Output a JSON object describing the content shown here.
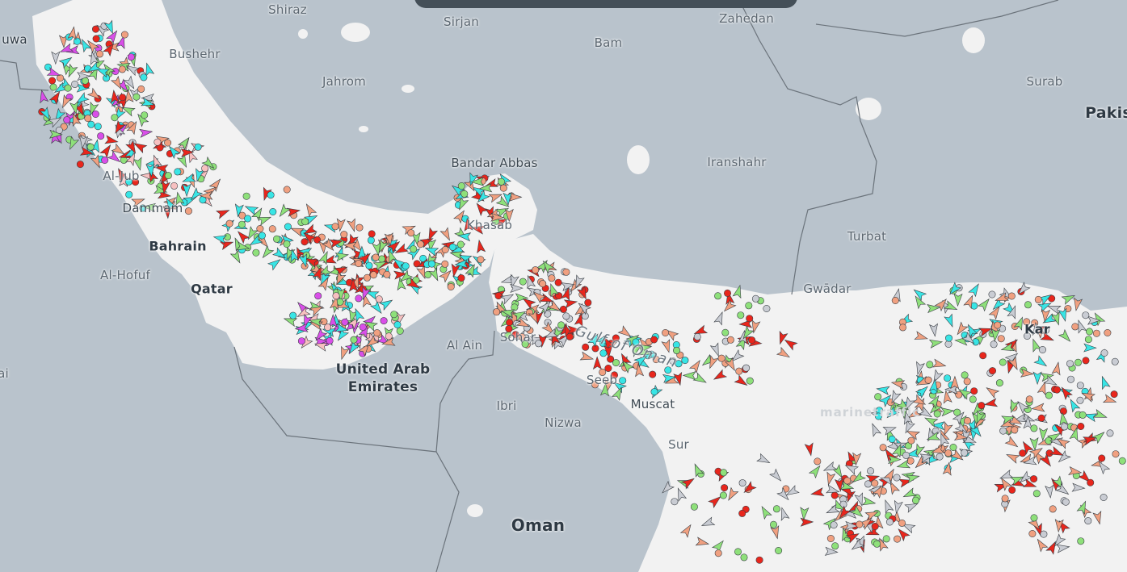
{
  "map": {
    "labels": {
      "shiraz": "Shiraz",
      "sirjan": "Sirjan",
      "zahedan": "Zahedan",
      "kuwait": "uwa",
      "bushehr": "Bushehr",
      "bam": "Bam",
      "jahrom": "Jahrom",
      "surab": "Surab",
      "pakistan": "Pakis",
      "bandar_abbas": "Bandar Abbas",
      "iranshahr": "Iranshahr",
      "al_jubail": "Al-Jub",
      "dammam": "Dammam",
      "bahrain": "Bahrain",
      "turbat": "Turbat",
      "khasab": "Khasab",
      "al_hofuf": "Al-Hofuf",
      "qatar": "Qatar",
      "gwadar": "Gwādar",
      "karachi": "Kar",
      "gulf_of_oman": "Gulf of Oman",
      "sohar": "Sohar",
      "al_ain": "Al Ain",
      "uae_line1": "United Arab",
      "uae_line2": "Emirates",
      "seeb": "Seeb",
      "muscat": "Muscat",
      "ibri": "Ibri",
      "nizwa": "Nizwa",
      "sur": "Sur",
      "oman": "Oman",
      "left_edge": "ai"
    },
    "watermark": "marinetraffic",
    "colors": {
      "water": "#b9c3cc",
      "land": "#f2f2f2",
      "tanker": "#e8261c",
      "cargo": "#8ee07a",
      "passenger": "#38e5e5",
      "fishing": "#f0a080",
      "unknown": "#c9ccd3",
      "pleasure": "#d94fe8",
      "highspeed": "#f5c518",
      "tug": "#3a7be0",
      "navaids": "#f7c0c0"
    }
  }
}
